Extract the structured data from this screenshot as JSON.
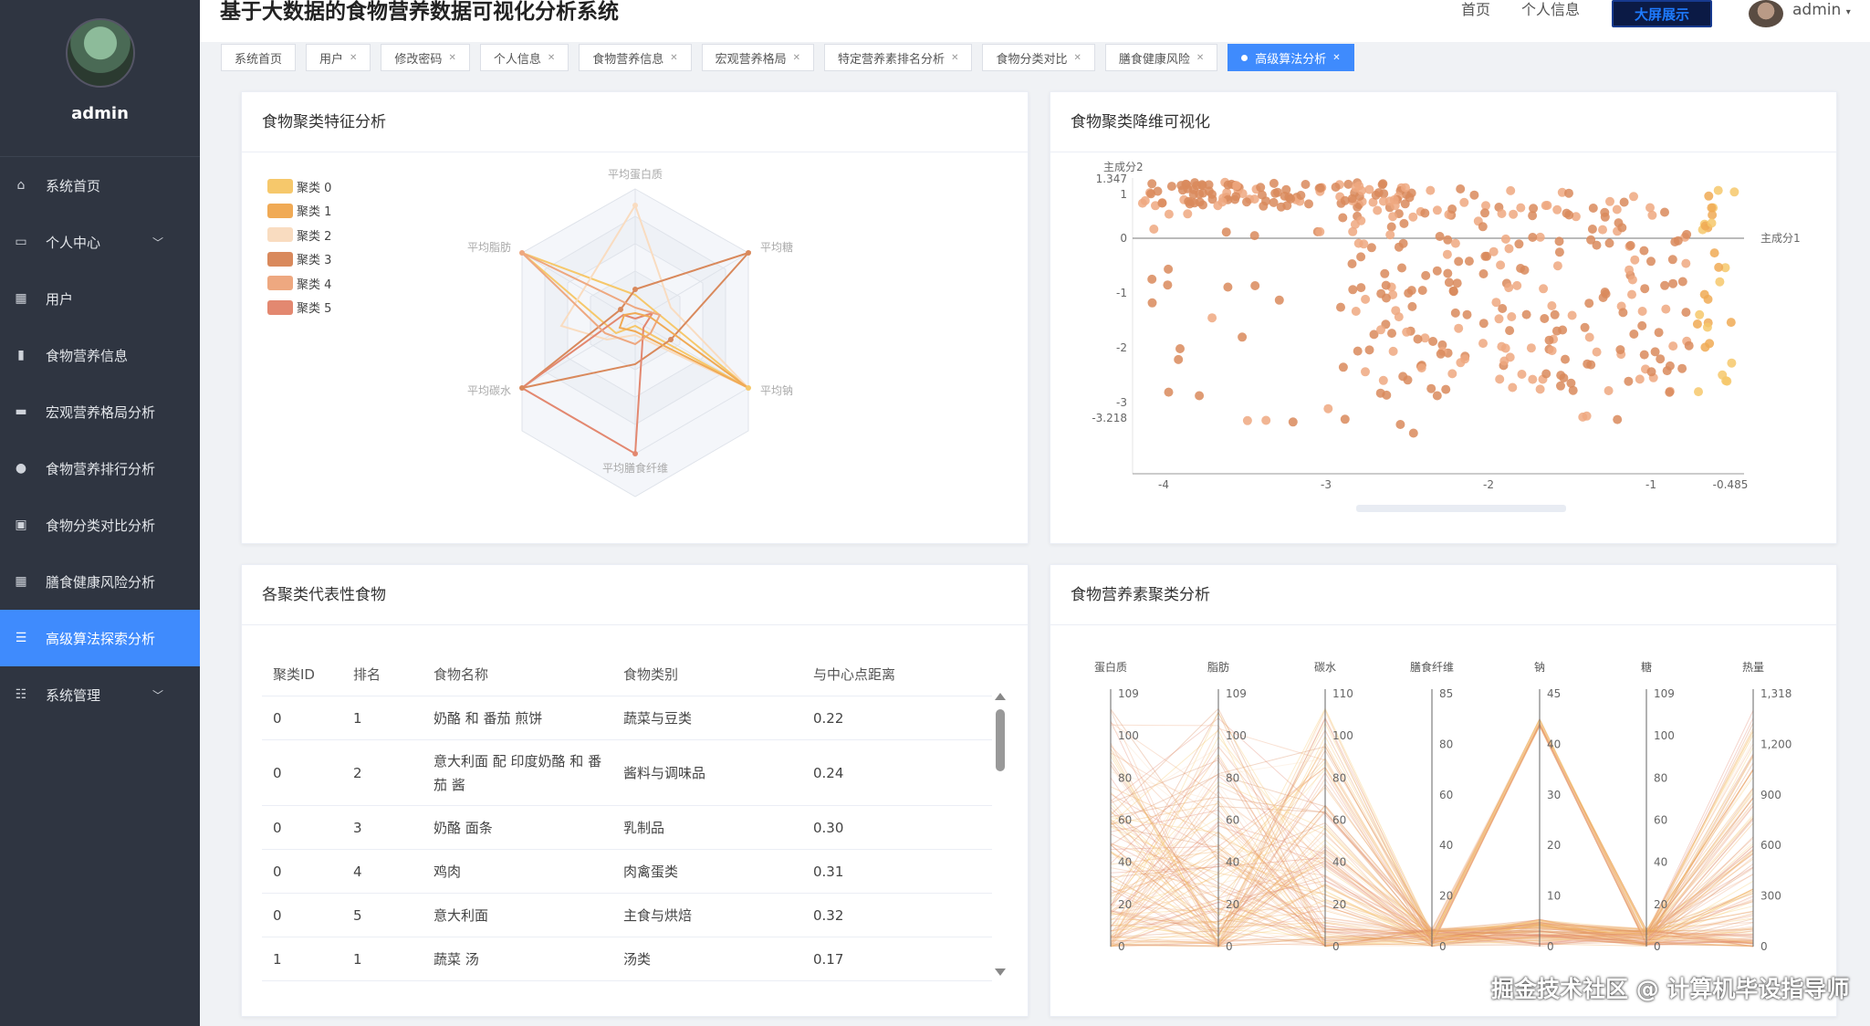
{
  "app": {
    "title": "基于大数据的食物营养数据可视化分析系统",
    "nav_home": "首页",
    "nav_profile": "个人信息",
    "big_screen": "大屏展示",
    "user": "admin"
  },
  "sidebar": {
    "username": "admin",
    "items": [
      {
        "label": "系统首页",
        "icon": "home-icon"
      },
      {
        "label": "个人中心",
        "icon": "wallet-icon"
      },
      {
        "label": "用户",
        "icon": "grid-icon"
      },
      {
        "label": "食物营养信息",
        "icon": "bar-icon"
      },
      {
        "label": "宏观营养格局分析",
        "icon": "monitor-icon"
      },
      {
        "label": "食物营养排行分析",
        "icon": "bulb-icon"
      },
      {
        "label": "食物分类对比分析",
        "icon": "doc-icon"
      },
      {
        "label": "膳食健康风险分析",
        "icon": "grid-icon"
      },
      {
        "label": "高级算法探索分析",
        "icon": "list-icon"
      },
      {
        "label": "系统管理",
        "icon": "sliders-icon"
      }
    ]
  },
  "tabs": [
    "系统首页",
    "用户",
    "修改密码",
    "个人信息",
    "食物营养信息",
    "宏观营养格局",
    "特定营养素排名分析",
    "食物分类对比",
    "膳食健康风险",
    "高级算法分析"
  ],
  "panels": {
    "radar_title": "食物聚类特征分析",
    "scatter_title": "食物聚类降维可视化",
    "table_title": "各聚类代表性食物",
    "parallel_title": "食物营养素聚类分析"
  },
  "colors": {
    "accent": "#3f8bfd",
    "sidebar_bg": "#2f3541",
    "clusters": [
      "#f6c86b",
      "#f0aa55",
      "#f9dcc0",
      "#d9895c",
      "#eea880",
      "#e38870"
    ]
  },
  "radar": {
    "legend": [
      "聚类 0",
      "聚类 1",
      "聚类 2",
      "聚类 3",
      "聚类 4",
      "聚类 5"
    ],
    "indicators": [
      "平均蛋白质",
      "平均糖",
      "平均钠",
      "平均膳食纤维",
      "平均碳水",
      "平均脂肪"
    ]
  },
  "scatter": {
    "xlabel": "主成分1",
    "ylabel": "主成分2",
    "xticks": [
      "-4",
      "-3",
      "-2",
      "-1",
      "-0.485"
    ],
    "yticks": [
      "1.347",
      "1",
      "0",
      "-1",
      "-2",
      "-3",
      "-3.218"
    ]
  },
  "table": {
    "headers": [
      "聚类ID",
      "排名",
      "食物名称",
      "食物类别",
      "与中心点距离"
    ],
    "rows": [
      [
        "0",
        "1",
        "奶酪 和 番茄 煎饼",
        "蔬菜与豆类",
        "0.22"
      ],
      [
        "0",
        "2",
        "意大利面 配 印度奶酪 和 番茄 酱",
        "酱料与调味品",
        "0.24"
      ],
      [
        "0",
        "3",
        "奶酪 面条",
        "乳制品",
        "0.30"
      ],
      [
        "0",
        "4",
        "鸡肉",
        "肉禽蛋类",
        "0.31"
      ],
      [
        "0",
        "5",
        "意大利面",
        "主食与烘焙",
        "0.32"
      ],
      [
        "1",
        "1",
        "蔬菜 汤",
        "汤类",
        "0.17"
      ]
    ]
  },
  "parallel": {
    "axes": [
      {
        "name": "蛋白质",
        "ticks": [
          "109",
          "100",
          "80",
          "60",
          "40",
          "20",
          "0"
        ]
      },
      {
        "name": "脂肪",
        "ticks": [
          "109",
          "100",
          "80",
          "60",
          "40",
          "20",
          "0"
        ]
      },
      {
        "name": "碳水",
        "ticks": [
          "110",
          "100",
          "80",
          "60",
          "40",
          "20",
          "0"
        ]
      },
      {
        "name": "膳食纤维",
        "ticks": [
          "85",
          "80",
          "60",
          "40",
          "20",
          "0"
        ]
      },
      {
        "name": "钠",
        "ticks": [
          "45",
          "40",
          "30",
          "20",
          "10",
          "0"
        ]
      },
      {
        "name": "糖",
        "ticks": [
          "109",
          "100",
          "80",
          "60",
          "40",
          "20",
          "0"
        ]
      },
      {
        "name": "热量",
        "ticks": [
          "1,318",
          "1,200",
          "900",
          "600",
          "300",
          "0"
        ]
      }
    ]
  },
  "watermark": "掘金技术社区 @ 计算机毕设指导师"
}
